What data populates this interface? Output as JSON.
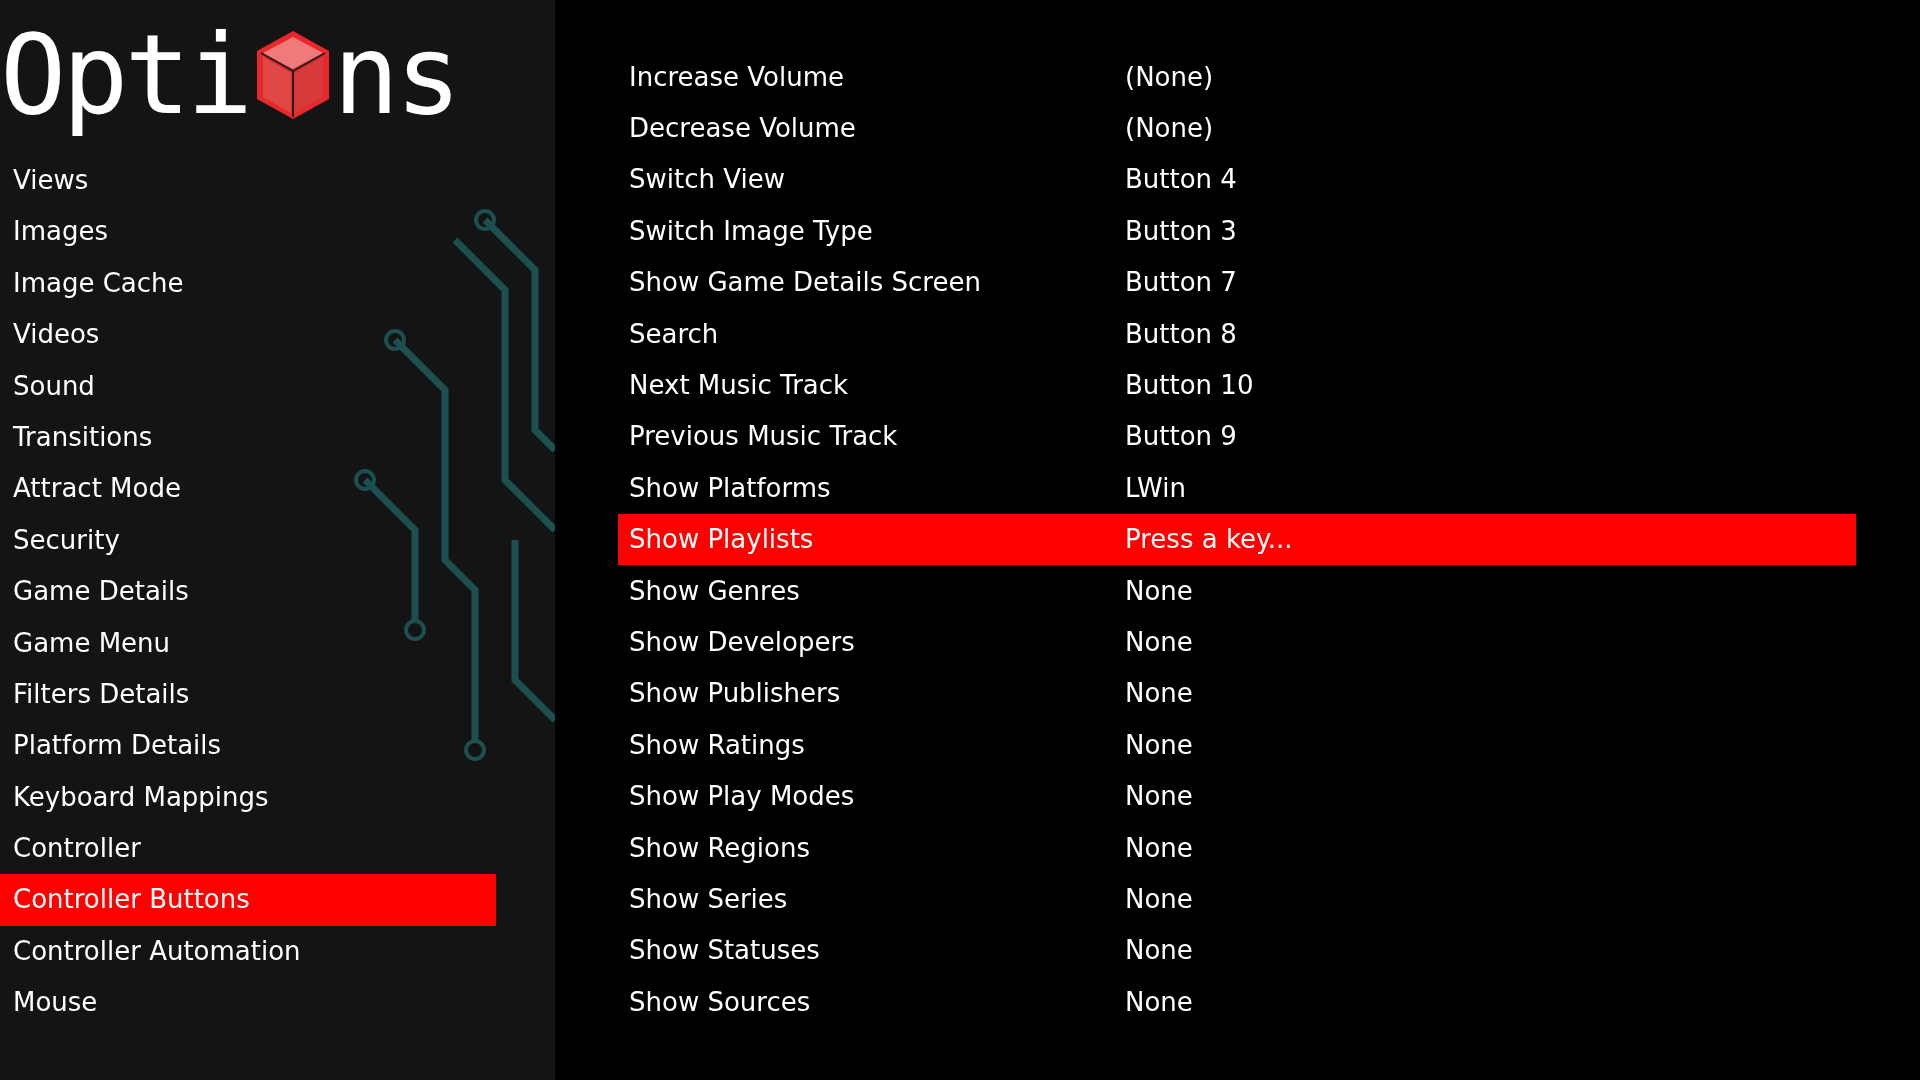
{
  "logo": {
    "before": "Opti",
    "after": "ns"
  },
  "sidebar": {
    "items": [
      {
        "label": "Views",
        "selected": false
      },
      {
        "label": "Images",
        "selected": false
      },
      {
        "label": "Image Cache",
        "selected": false
      },
      {
        "label": "Videos",
        "selected": false
      },
      {
        "label": "Sound",
        "selected": false
      },
      {
        "label": "Transitions",
        "selected": false
      },
      {
        "label": "Attract Mode",
        "selected": false
      },
      {
        "label": "Security",
        "selected": false
      },
      {
        "label": "Game Details",
        "selected": false
      },
      {
        "label": "Game Menu",
        "selected": false
      },
      {
        "label": "Filters Details",
        "selected": false
      },
      {
        "label": "Platform Details",
        "selected": false
      },
      {
        "label": "Keyboard Mappings",
        "selected": false
      },
      {
        "label": "Controller",
        "selected": false
      },
      {
        "label": "Controller Buttons",
        "selected": true
      },
      {
        "label": "Controller Automation",
        "selected": false
      },
      {
        "label": "Mouse",
        "selected": false
      }
    ]
  },
  "mappings": [
    {
      "action": "Increase Volume",
      "binding": "(None)",
      "selected": false
    },
    {
      "action": "Decrease Volume",
      "binding": "(None)",
      "selected": false
    },
    {
      "action": "Switch View",
      "binding": "Button 4",
      "selected": false
    },
    {
      "action": "Switch Image Type",
      "binding": "Button 3",
      "selected": false
    },
    {
      "action": "Show Game Details Screen",
      "binding": "Button 7",
      "selected": false
    },
    {
      "action": "Search",
      "binding": "Button 8",
      "selected": false
    },
    {
      "action": "Next Music Track",
      "binding": "Button 10",
      "selected": false
    },
    {
      "action": "Previous Music Track",
      "binding": "Button 9",
      "selected": false
    },
    {
      "action": "Show Platforms",
      "binding": "LWin",
      "selected": false
    },
    {
      "action": "Show Playlists",
      "binding": "Press a key...",
      "selected": true
    },
    {
      "action": "Show Genres",
      "binding": "None",
      "selected": false
    },
    {
      "action": "Show Developers",
      "binding": "None",
      "selected": false
    },
    {
      "action": "Show Publishers",
      "binding": "None",
      "selected": false
    },
    {
      "action": "Show Ratings",
      "binding": "None",
      "selected": false
    },
    {
      "action": "Show Play Modes",
      "binding": "None",
      "selected": false
    },
    {
      "action": "Show Regions",
      "binding": "None",
      "selected": false
    },
    {
      "action": "Show Series",
      "binding": "None",
      "selected": false
    },
    {
      "action": "Show Statuses",
      "binding": "None",
      "selected": false
    },
    {
      "action": "Show Sources",
      "binding": "None",
      "selected": false
    }
  ]
}
